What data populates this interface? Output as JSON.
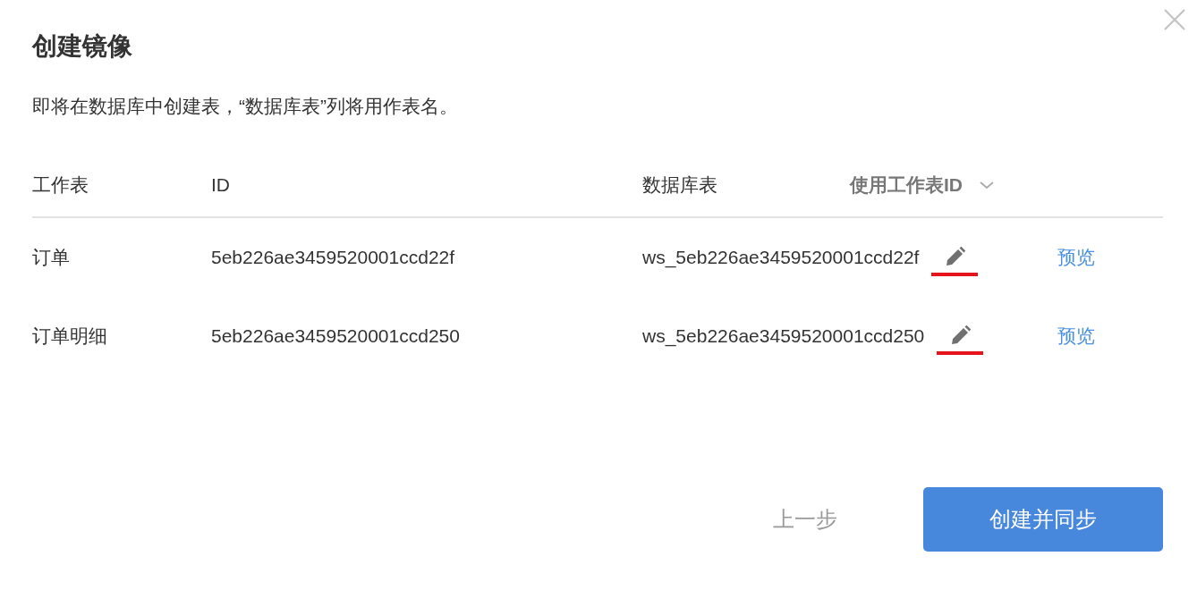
{
  "dialog": {
    "title": "创建镜像",
    "description": "即将在数据库中创建表，“数据库表”列将用作表名。"
  },
  "table": {
    "columns": [
      "工作表",
      "ID",
      "数据库表"
    ],
    "name_source": {
      "label": "使用工作表ID"
    },
    "rows": [
      {
        "sheet": "订单",
        "id": "5eb226ae3459520001ccd22f",
        "db_table": "ws_5eb226ae3459520001ccd22f",
        "preview": "预览",
        "underlined": true
      },
      {
        "sheet": "订单明细",
        "id": "5eb226ae3459520001ccd250",
        "db_table": "ws_5eb226ae3459520001ccd250",
        "preview": "预览",
        "underlined": true
      }
    ]
  },
  "buttons": {
    "back": {
      "label": "上一步",
      "disabled": true
    },
    "primary": {
      "label": "创建并同步"
    }
  }
}
